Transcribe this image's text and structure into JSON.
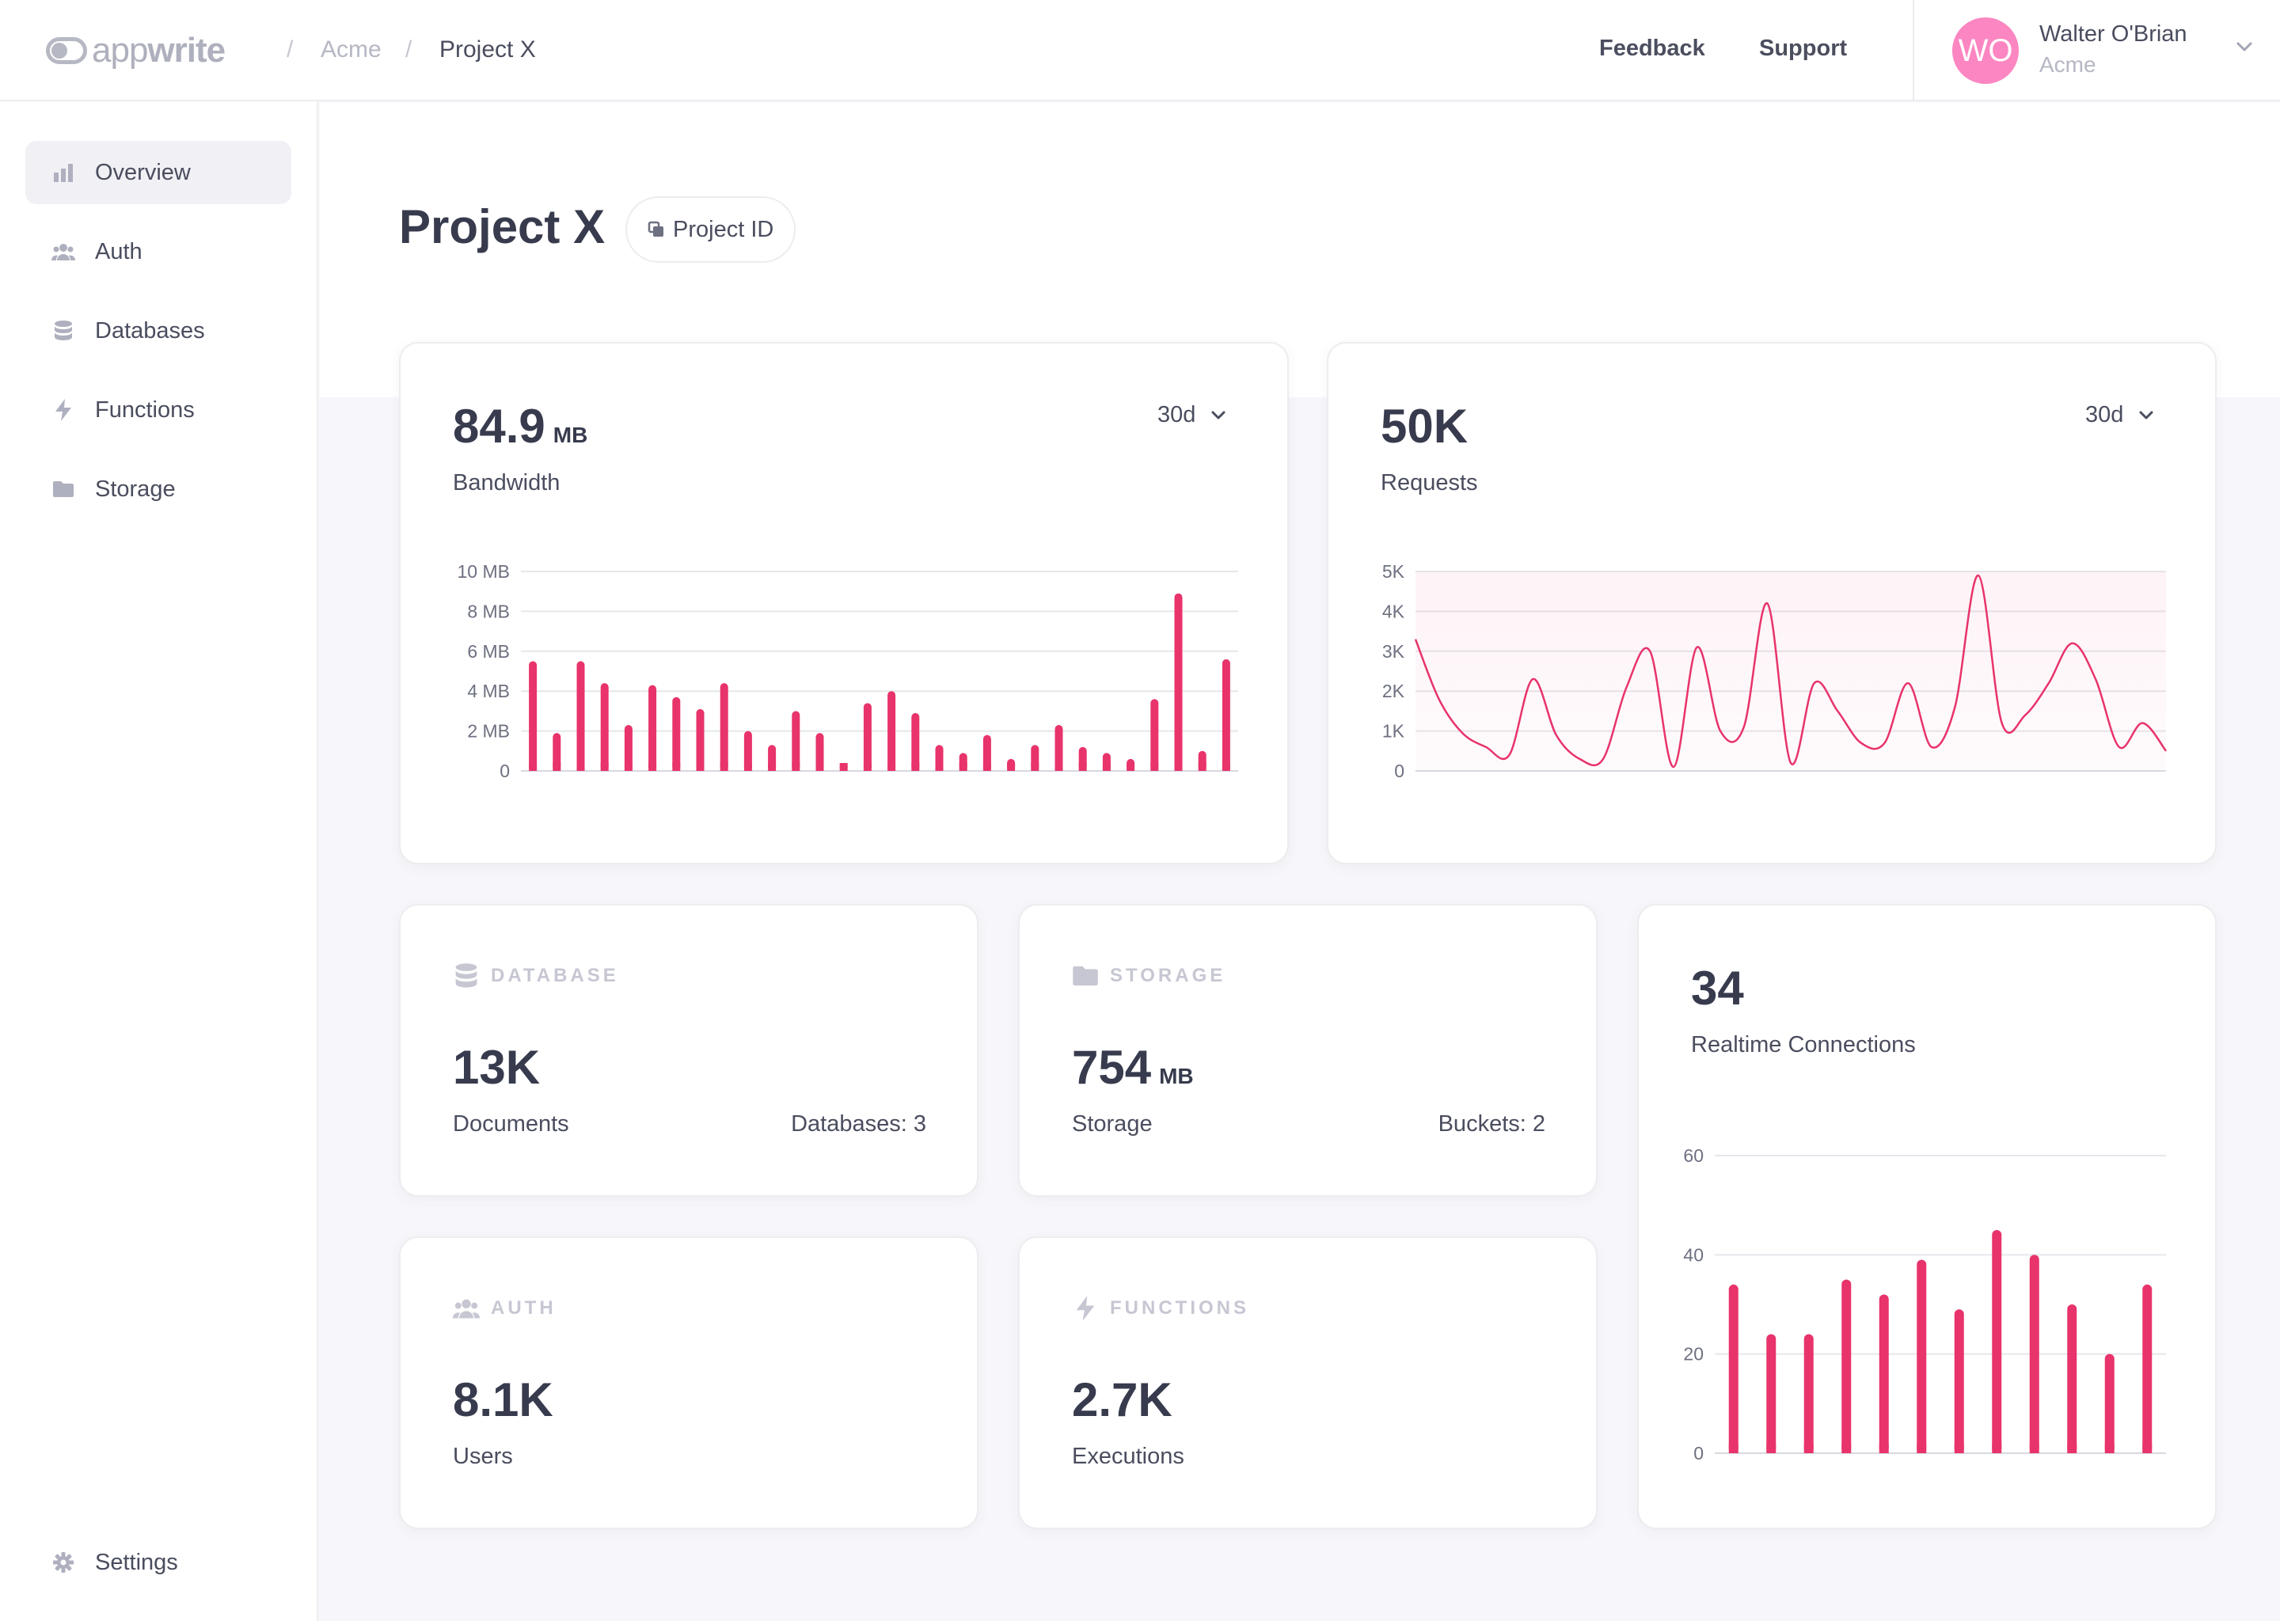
{
  "brand": {
    "name_light": "app",
    "name_bold": "write"
  },
  "breadcrumb": {
    "org": "Acme",
    "project": "Project X",
    "separator": "/"
  },
  "header": {
    "feedback": "Feedback",
    "support": "Support"
  },
  "user": {
    "initials": "WO",
    "name": "Walter O'Brian",
    "org": "Acme",
    "avatar_color": "#fc86c2"
  },
  "sidebar": {
    "items": [
      {
        "label": "Overview",
        "icon": "bar-chart-icon",
        "active": true
      },
      {
        "label": "Auth",
        "icon": "users-icon"
      },
      {
        "label": "Databases",
        "icon": "database-icon"
      },
      {
        "label": "Functions",
        "icon": "lightning-icon"
      },
      {
        "label": "Storage",
        "icon": "folder-icon"
      }
    ],
    "settings": {
      "label": "Settings",
      "icon": "gear-icon"
    }
  },
  "page": {
    "title": "Project X",
    "project_id_button": "Project ID"
  },
  "accent_color": "#e8336b",
  "cards": {
    "bandwidth": {
      "value": "84.9",
      "unit": "MB",
      "label": "Bandwidth",
      "range": "30d"
    },
    "requests": {
      "value": "50K",
      "label": "Requests",
      "range": "30d"
    },
    "database": {
      "tag": "DATABASE",
      "value": "13K",
      "label": "Documents",
      "meta": "Databases: 3"
    },
    "storage": {
      "tag": "STORAGE",
      "value": "754",
      "unit": "MB",
      "label": "Storage",
      "meta": "Buckets: 2"
    },
    "auth": {
      "tag": "AUTH",
      "value": "8.1K",
      "label": "Users"
    },
    "functions": {
      "tag": "FUNCTIONS",
      "value": "2.7K",
      "label": "Executions"
    },
    "realtime": {
      "value": "34",
      "label": "Realtime Connections"
    }
  },
  "chart_data": [
    {
      "id": "bandwidth",
      "type": "bar",
      "ylim": [
        0,
        10
      ],
      "y_ticks": [
        "0",
        "2 MB",
        "4 MB",
        "6 MB",
        "8 MB",
        "10 MB"
      ],
      "y_tick_values": [
        0,
        2,
        4,
        6,
        8,
        10
      ],
      "values": [
        5.5,
        1.9,
        5.5,
        4.4,
        2.3,
        4.3,
        3.7,
        3.1,
        4.4,
        2.0,
        1.3,
        3.0,
        1.9,
        0.4,
        3.4,
        4.0,
        2.9,
        1.3,
        0.9,
        1.8,
        0.6,
        1.3,
        2.3,
        1.2,
        0.9,
        0.6,
        3.6,
        8.9,
        1.0,
        5.6
      ]
    },
    {
      "id": "requests",
      "type": "area",
      "ylim": [
        0,
        5000
      ],
      "y_ticks": [
        "0",
        "1K",
        "2K",
        "3K",
        "4K",
        "5K"
      ],
      "y_tick_values": [
        0,
        1000,
        2000,
        3000,
        4000,
        5000
      ],
      "values": [
        3300,
        1800,
        950,
        600,
        400,
        2300,
        900,
        300,
        300,
        2100,
        3000,
        100,
        3100,
        1000,
        1100,
        4200,
        200,
        2200,
        1500,
        700,
        700,
        2200,
        600,
        1600,
        4900,
        1200,
        1400,
        2200,
        3200,
        2300,
        600,
        1200,
        500
      ]
    },
    {
      "id": "realtime",
      "type": "bar",
      "ylim": [
        0,
        60
      ],
      "y_ticks": [
        "0",
        "20",
        "40",
        "60"
      ],
      "y_tick_values": [
        0,
        20,
        40,
        60
      ],
      "values": [
        34,
        24,
        24,
        35,
        32,
        39,
        29,
        45,
        40,
        30,
        20,
        34
      ]
    }
  ]
}
